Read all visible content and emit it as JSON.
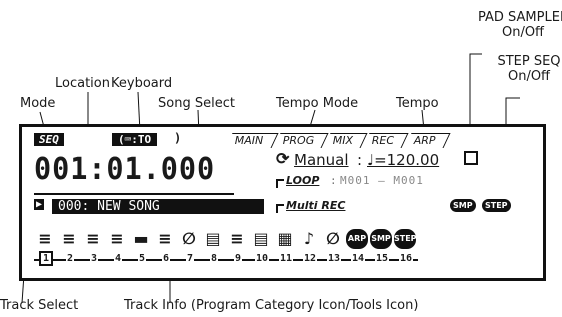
{
  "annotations": {
    "pad_sampler": [
      "PAD SAMPLER",
      "On/Off"
    ],
    "step_seq": [
      "STEP SEQ",
      "On/Off"
    ],
    "location": "Location",
    "keyboard": "Keyboard",
    "mode": "Mode",
    "song_select": "Song Select",
    "tempo_mode": "Tempo Mode",
    "tempo": "Tempo",
    "track_select": "Track Select",
    "track_info": "Track Info (Program Category Icon/Tools Icon)"
  },
  "lcd": {
    "mode": "SEQ",
    "keyboard": "(⌨:TO",
    "tabs": [
      "MAIN",
      "PROG",
      "MIX",
      "REC",
      "ARP"
    ],
    "location": "001:01.000",
    "tempo_mode": "Manual",
    "tempo": "♩=120.00",
    "loop": "LOOP",
    "loop_range": "M001 – M001",
    "multi_rec": "Multi REC",
    "song": "000: NEW SONG",
    "song_arrow": "▶",
    "pad_badge": "SMP",
    "step_badge": "STEP",
    "track_icons": [
      "≡",
      "≡",
      "≡",
      "≡",
      "▬",
      "≡",
      "∅",
      "▤",
      "≡",
      "▤",
      "▦",
      "♪",
      "∅",
      "ARP",
      "SMP",
      "STEP"
    ],
    "tracks": [
      "1",
      "2",
      "3",
      "4",
      "5",
      "6",
      "7",
      "8",
      "9",
      "10",
      "11",
      "12",
      "13",
      "14",
      "15",
      "16"
    ]
  }
}
